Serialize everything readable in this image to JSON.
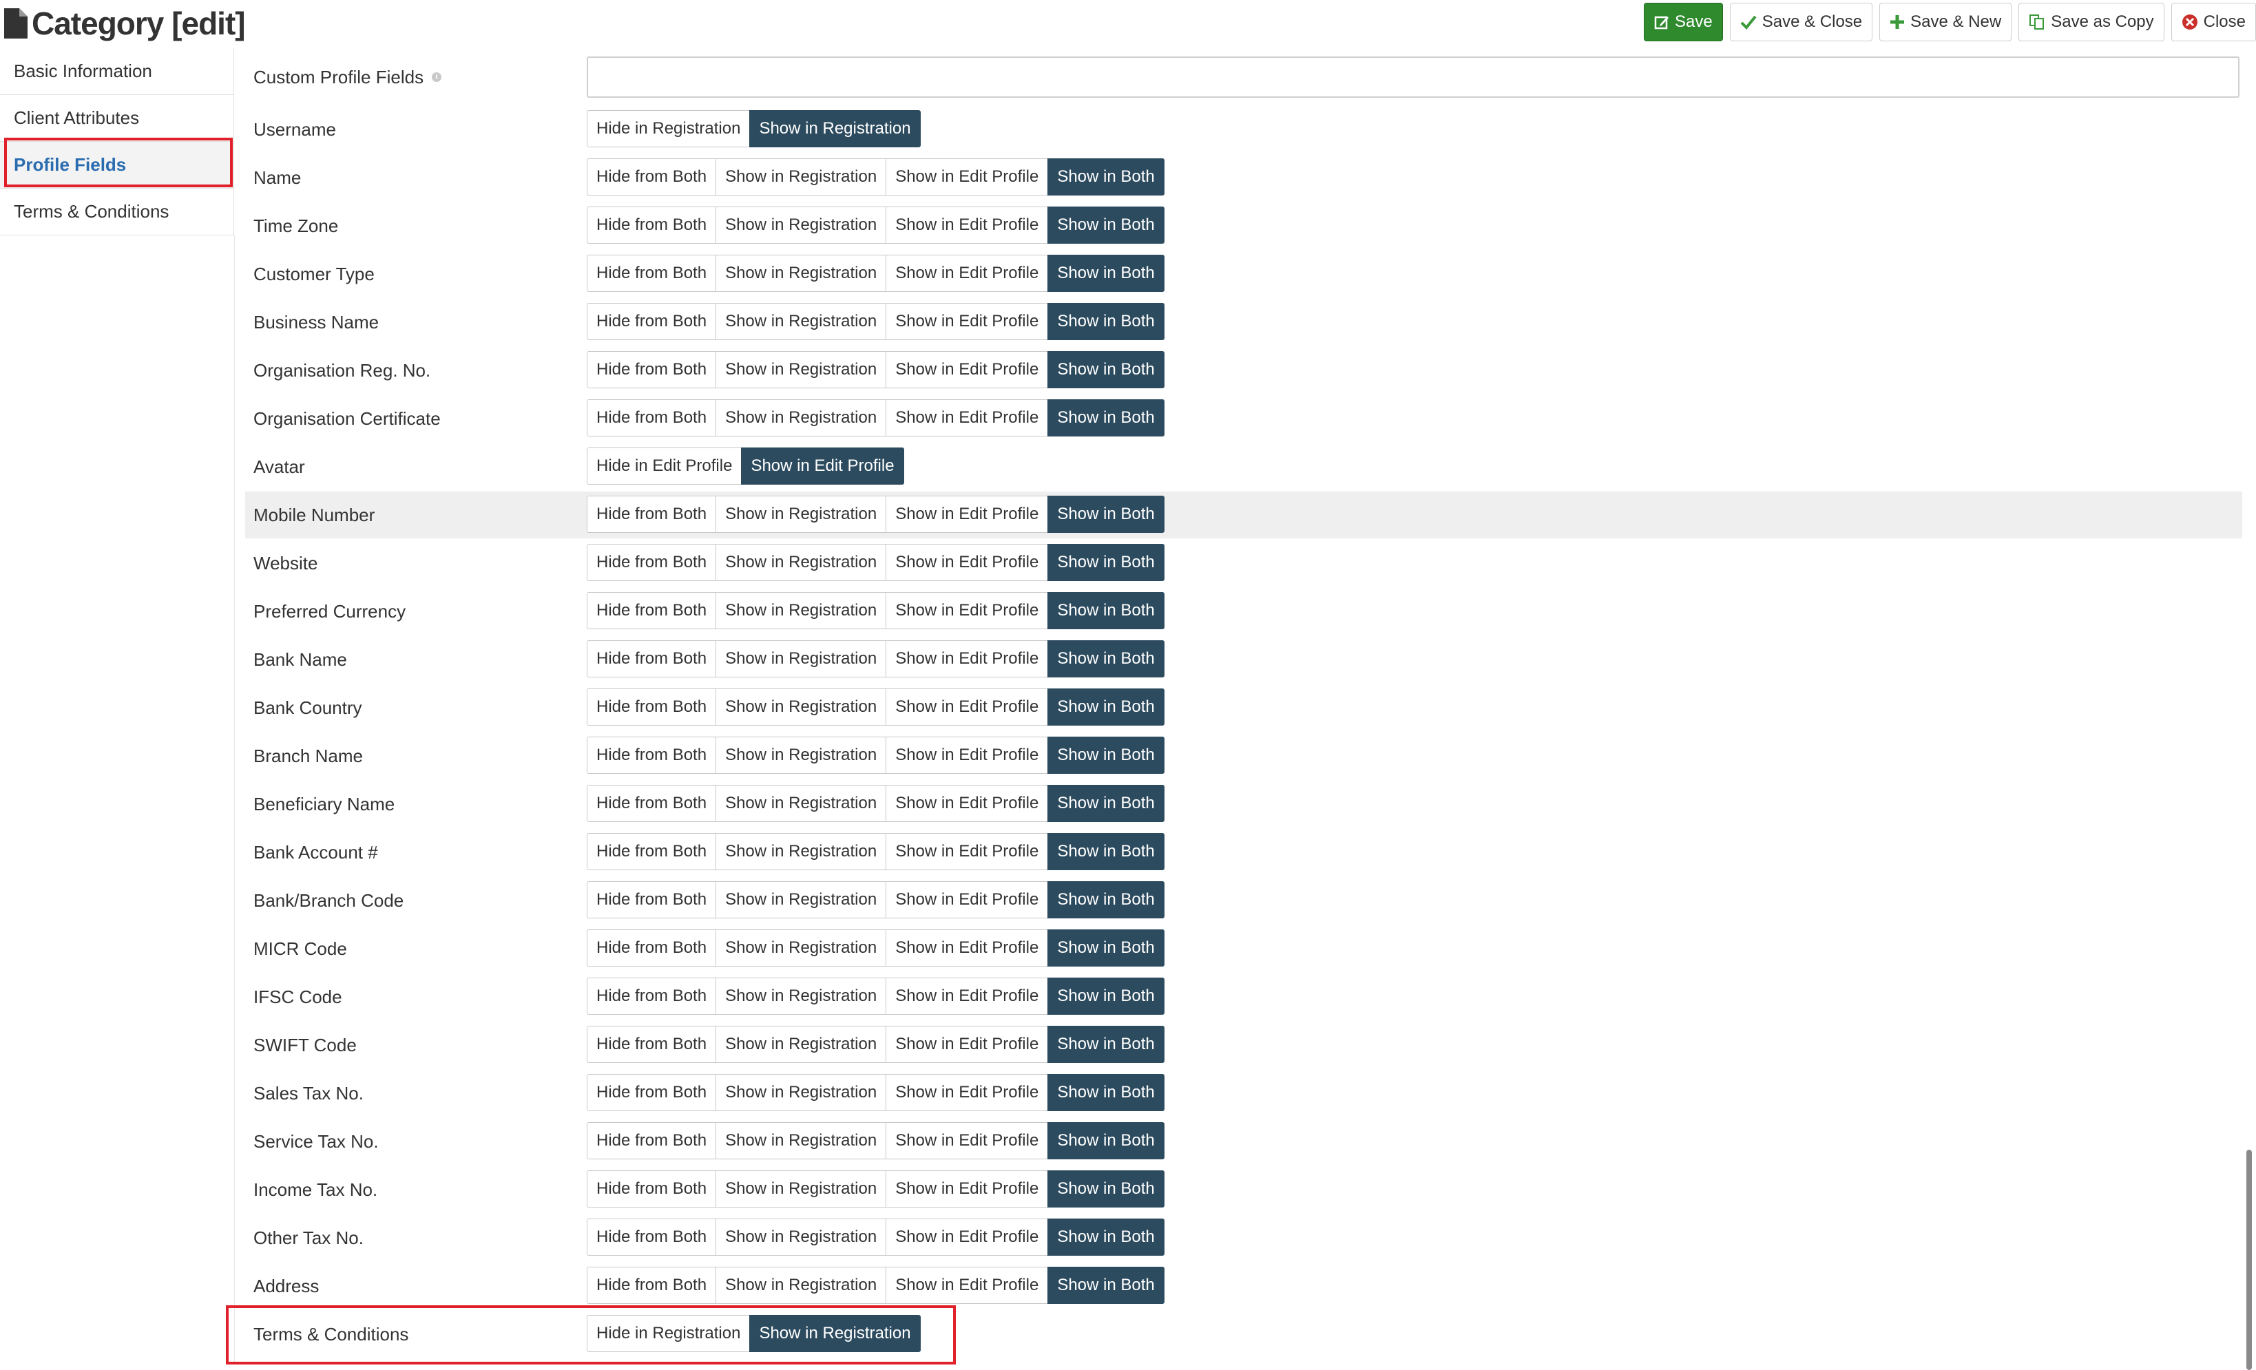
{
  "header": {
    "title": "Category [edit]",
    "doc_icon": "document-icon",
    "buttons": {
      "save": "Save",
      "save_close": "Save & Close",
      "save_new": "Save & New",
      "save_copy": "Save as Copy",
      "close": "Close"
    }
  },
  "sidebar": {
    "items": [
      {
        "label": "Basic Information"
      },
      {
        "label": "Client Attributes"
      },
      {
        "label": "Profile Fields"
      },
      {
        "label": "Terms & Conditions"
      }
    ],
    "active_index": 2
  },
  "main": {
    "custom_profile_fields": {
      "label": "Custom Profile Fields",
      "value": ""
    },
    "options": {
      "two_reg": [
        "Hide in Registration",
        "Show in Registration"
      ],
      "two_edit": [
        "Hide in Edit Profile",
        "Show in Edit Profile"
      ],
      "four": [
        "Hide from Both",
        "Show in Registration",
        "Show in Edit Profile",
        "Show in Both"
      ]
    },
    "fields": [
      {
        "label": "Username",
        "type": "two_reg",
        "selected": 1
      },
      {
        "label": "Name",
        "type": "four",
        "selected": 3
      },
      {
        "label": "Time Zone",
        "type": "four",
        "selected": 3
      },
      {
        "label": "Customer Type",
        "type": "four",
        "selected": 3
      },
      {
        "label": "Business Name",
        "type": "four",
        "selected": 3
      },
      {
        "label": "Organisation Reg. No.",
        "type": "four",
        "selected": 3
      },
      {
        "label": "Organisation Certificate",
        "type": "four",
        "selected": 3
      },
      {
        "label": "Avatar",
        "type": "two_edit",
        "selected": 1
      },
      {
        "label": "Mobile Number",
        "type": "four",
        "selected": 3,
        "highlighted": true
      },
      {
        "label": "Website",
        "type": "four",
        "selected": 3
      },
      {
        "label": "Preferred Currency",
        "type": "four",
        "selected": 3
      },
      {
        "label": "Bank Name",
        "type": "four",
        "selected": 3
      },
      {
        "label": "Bank Country",
        "type": "four",
        "selected": 3
      },
      {
        "label": "Branch Name",
        "type": "four",
        "selected": 3
      },
      {
        "label": "Beneficiary Name",
        "type": "four",
        "selected": 3
      },
      {
        "label": "Bank Account #",
        "type": "four",
        "selected": 3
      },
      {
        "label": "Bank/Branch Code",
        "type": "four",
        "selected": 3
      },
      {
        "label": "MICR Code",
        "type": "four",
        "selected": 3
      },
      {
        "label": "IFSC Code",
        "type": "four",
        "selected": 3
      },
      {
        "label": "SWIFT Code",
        "type": "four",
        "selected": 3
      },
      {
        "label": "Sales Tax No.",
        "type": "four",
        "selected": 3
      },
      {
        "label": "Service Tax No.",
        "type": "four",
        "selected": 3
      },
      {
        "label": "Income Tax No.",
        "type": "four",
        "selected": 3
      },
      {
        "label": "Other Tax No.",
        "type": "four",
        "selected": 3
      },
      {
        "label": "Address",
        "type": "four",
        "selected": 3
      },
      {
        "label": "Terms & Conditions",
        "type": "two_reg",
        "selected": 1
      }
    ]
  },
  "colors": {
    "save_green": "#2f8a2e",
    "selected_dark": "#2d4b5f",
    "active_link": "#2a6cb0",
    "highlight_red": "#e0202a"
  }
}
